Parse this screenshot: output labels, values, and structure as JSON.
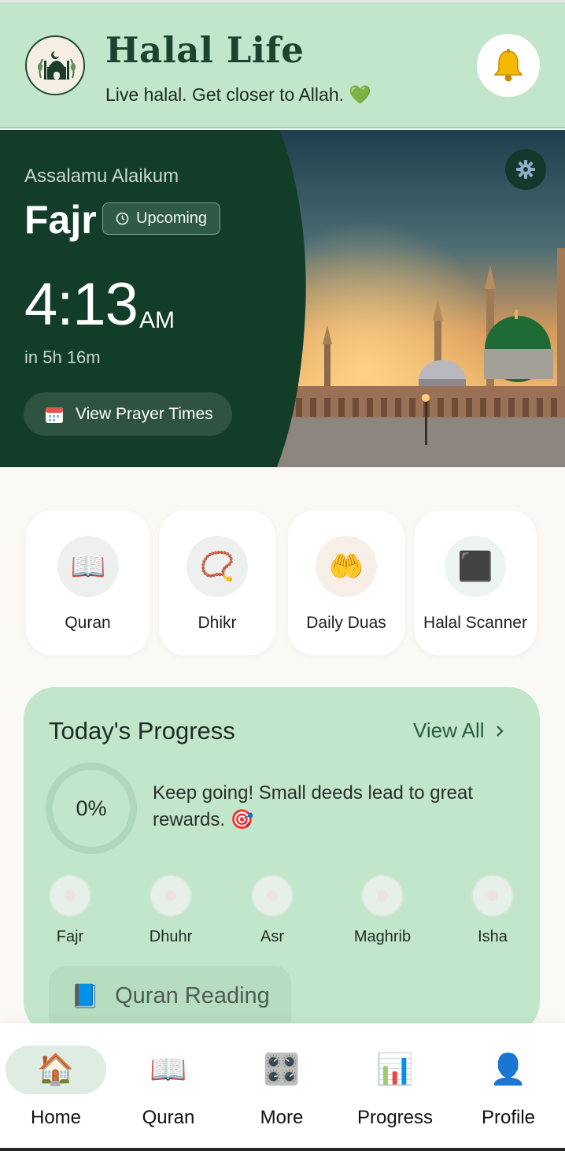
{
  "header": {
    "title": "Halal Life",
    "tagline": "Live halal. Get closer to Allah. 💚",
    "bell_icon": "bell-icon"
  },
  "hero": {
    "greeting": "Assalamu Alaikum",
    "prayer": "Fajr",
    "badge": "Upcoming",
    "time": "4:13",
    "ampm": "AM",
    "countdown": "in 5h 16m",
    "button": "View Prayer Times",
    "settings_icon": "gear-icon"
  },
  "tiles": [
    {
      "label": "Quran",
      "icon": "📖",
      "bg": "#eef0ef"
    },
    {
      "label": "Dhikr",
      "icon": "📿",
      "bg": "#eef0ef"
    },
    {
      "label": "Daily Duas",
      "icon": "🤲",
      "bg": "#f7efe7"
    },
    {
      "label": "Halal Scanner",
      "icon": "⬛",
      "bg": "#eef5f1"
    }
  ],
  "progress": {
    "title": "Today's Progress",
    "view_all": "View All",
    "percent": "0%",
    "message": "Keep going! Small deeds lead to great rewards. 🎯",
    "prayers": [
      "Fajr",
      "Dhuhr",
      "Asr",
      "Maghrib",
      "Isha"
    ],
    "quran_chip": "Quran Reading",
    "quran_icon": "📘"
  },
  "nav": {
    "items": [
      {
        "label": "Home",
        "icon": "🏠",
        "active": true
      },
      {
        "label": "Quran",
        "icon": "📖",
        "active": false
      },
      {
        "label": "More",
        "icon": "🎛️",
        "active": false
      },
      {
        "label": "Progress",
        "icon": "📊",
        "active": false
      },
      {
        "label": "Profile",
        "icon": "👤",
        "active": false
      }
    ]
  },
  "colors": {
    "header_bg": "#c1e6c9",
    "hero_green": "#123d28",
    "accent": "#1a4330"
  }
}
